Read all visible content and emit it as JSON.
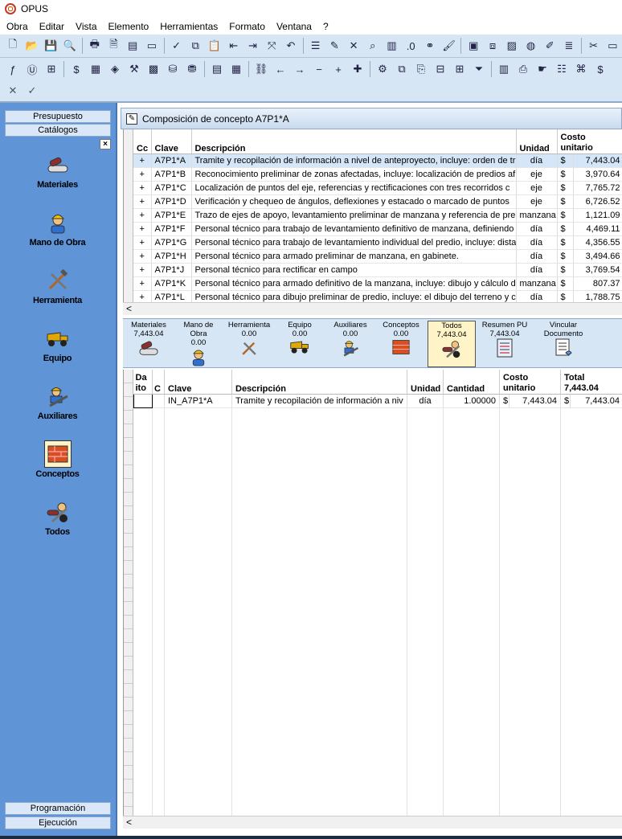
{
  "app": {
    "title": "OPUS"
  },
  "menu": [
    "Obra",
    "Editar",
    "Vista",
    "Elemento",
    "Herramientas",
    "Formato",
    "Ventana",
    "?"
  ],
  "sidebar": {
    "top_buttons": [
      "Presupuesto",
      "Catálogos"
    ],
    "close_label": "×",
    "items": [
      {
        "label": "Materiales",
        "icon": "pipes-icon"
      },
      {
        "label": "Mano de Obra",
        "icon": "worker-icon"
      },
      {
        "label": "Herramienta",
        "icon": "tools-icon"
      },
      {
        "label": "Equipo",
        "icon": "dump-truck-icon"
      },
      {
        "label": "Auxiliares",
        "icon": "auxiliary-icon"
      },
      {
        "label": "Conceptos",
        "icon": "bricks-icon"
      },
      {
        "label": "Todos",
        "icon": "all-icon"
      }
    ],
    "selected": "Conceptos",
    "bottom_buttons": [
      "Programación",
      "Ejecución"
    ]
  },
  "panel": {
    "title": "Composición de concepto A7P1*A"
  },
  "grid1": {
    "headers": [
      "Cc",
      "Clave",
      "Descripción",
      "Unidad",
      "Costo unitario"
    ],
    "rows": [
      {
        "cc": "+",
        "clave": "A7P1*A",
        "desc": "Tramite y recopilación de información a nivel de anteproyecto, incluye: orden de tr",
        "unidad": "día",
        "cur": "$",
        "costo": "7,443.04"
      },
      {
        "cc": "+",
        "clave": "A7P1*B",
        "desc": "Reconocimiento preliminar de zonas afectadas, incluye: localización de predios af",
        "unidad": "eje",
        "cur": "$",
        "costo": "3,970.64"
      },
      {
        "cc": "+",
        "clave": "A7P1*C",
        "desc": "Localización de puntos del eje, referencias y rectificaciones con tres recorridos c",
        "unidad": "eje",
        "cur": "$",
        "costo": "7,765.72"
      },
      {
        "cc": "+",
        "clave": "A7P1*D",
        "desc": "Verificación y chequeo de ángulos, deflexiones y estacado o marcado de puntos",
        "unidad": "eje",
        "cur": "$",
        "costo": "6,726.52"
      },
      {
        "cc": "+",
        "clave": "A7P1*E",
        "desc": "Trazo de ejes de apoyo, levantamiento preliminar de manzana y referencia de pre",
        "unidad": "manzana",
        "cur": "$",
        "costo": "1,121.09"
      },
      {
        "cc": "+",
        "clave": "A7P1*F",
        "desc": "Personal técnico para trabajo de levantamiento definitivo de manzana, definiendo",
        "unidad": "día",
        "cur": "$",
        "costo": "4,469.11"
      },
      {
        "cc": "+",
        "clave": "A7P1*G",
        "desc": "Personal técnico para trabajo de levantamiento individual del predio, incluye: dista",
        "unidad": "día",
        "cur": "$",
        "costo": "4,356.55"
      },
      {
        "cc": "+",
        "clave": "A7P1*H",
        "desc": "Personal técnico para armado preliminar de manzana, en gabinete.",
        "unidad": "día",
        "cur": "$",
        "costo": "3,494.66"
      },
      {
        "cc": "+",
        "clave": "A7P1*J",
        "desc": "Personal técnico para rectificar en campo",
        "unidad": "día",
        "cur": "$",
        "costo": "3,769.54"
      },
      {
        "cc": "+",
        "clave": "A7P1*K",
        "desc": "Personal técnico para armado definitivo de la manzana, incluye: dibujo y cálculo d",
        "unidad": "manzana",
        "cur": "$",
        "costo": "807.37"
      },
      {
        "cc": "+",
        "clave": "A7P1*L",
        "desc": "Personal técnico para dibujo preliminar de predio, incluye: el dibujo del terreno y c",
        "unidad": "día",
        "cur": "$",
        "costo": "1,788.75"
      }
    ]
  },
  "tabs": [
    {
      "label": "Materiales",
      "value": "7,443.04",
      "icon": "pipes-icon"
    },
    {
      "label": "Mano de Obra",
      "value": "0.00",
      "icon": "worker-icon"
    },
    {
      "label": "Herramienta",
      "value": "0.00",
      "icon": "tools-icon"
    },
    {
      "label": "Equipo",
      "value": "0.00",
      "icon": "dump-truck-icon"
    },
    {
      "label": "Auxiliares",
      "value": "0.00",
      "icon": "auxiliary-icon"
    },
    {
      "label": "Conceptos",
      "value": "0.00",
      "icon": "bricks-icon"
    },
    {
      "label": "Todos",
      "value": "7,443.04",
      "icon": "all-icon"
    },
    {
      "label": "Resumen PU",
      "value": "7,443.04",
      "icon": "summary-icon"
    },
    {
      "label": "Vincular Documento",
      "value": "",
      "icon": "document-icon"
    }
  ],
  "grid2": {
    "headers": [
      "Da ito",
      "C",
      "Clave",
      "Descripción",
      "Unidad",
      "Cantidad",
      "Costo unitario",
      "Total"
    ],
    "total_header_value": "7,443.04",
    "rows": [
      {
        "clave": "IN_A7P1*A",
        "desc": "Tramite y recopilación de información a niv",
        "unidad": "día",
        "cantidad": "1.00000",
        "cur1": "$",
        "costo": "7,443.04",
        "cur2": "$",
        "total": "7,443.04"
      }
    ]
  },
  "scroll_label": "<"
}
